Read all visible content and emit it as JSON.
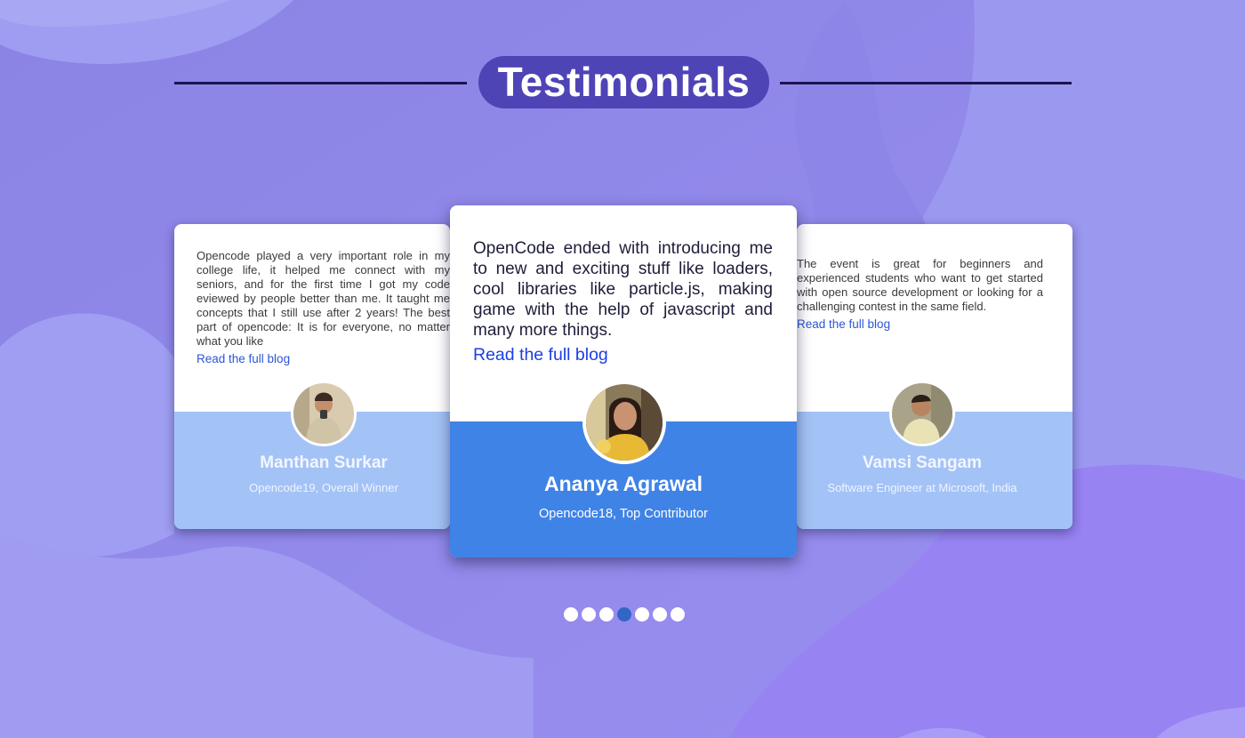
{
  "section": {
    "title": "Testimonials"
  },
  "testimonials": [
    {
      "text": "Opencode played a very important role in my college life, it helped me connect with my seniors, and for the first time I got my code eviewed by people better than me. It taught me concepts that I still use after 2 years! The best part of opencode: It is for everyone, no matter what you like",
      "link": "Read the full blog",
      "name": "Manthan Surkar",
      "role": "Opencode19, Overall Winner"
    },
    {
      "text": "OpenCode ended with introducing me to new and exciting stuff like loaders, cool libraries like particle.js, making game with the help of javascript and many more things.",
      "link": "Read the full blog",
      "name": "Ananya Agrawal",
      "role": "Opencode18, Top Contributor"
    },
    {
      "text": "The event is great for beginners and experienced students who want to get started with open source development or looking for a challenging contest in the same field.",
      "link": "Read the full blog",
      "name": "Vamsi Sangam",
      "role": "Software Engineer at Microsoft, India"
    }
  ],
  "carousel": {
    "dot_count": 7,
    "active_index": 3
  },
  "colors": {
    "accent_pill": "#4e44b6",
    "center_card_bottom": "#3f83e6",
    "side_card_bottom": "#a3c3f7",
    "link": "#1d3fe0",
    "active_dot": "#3166c6"
  }
}
